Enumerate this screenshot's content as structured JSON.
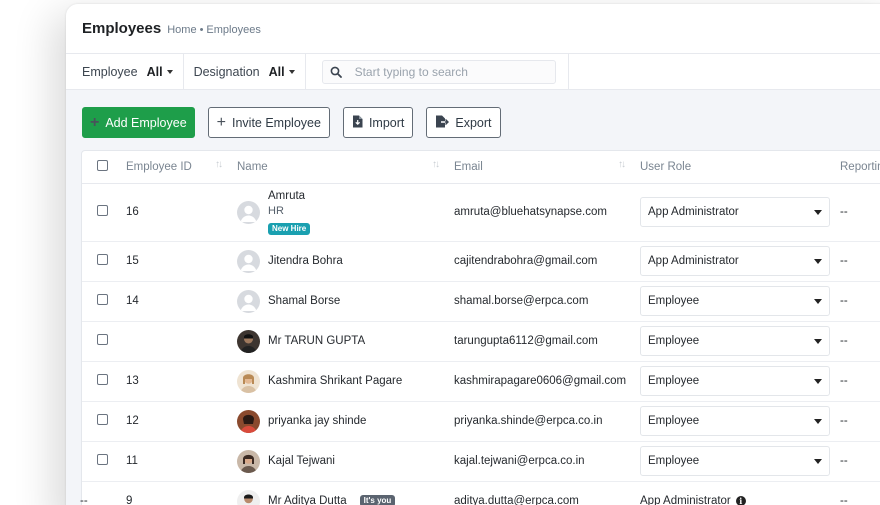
{
  "header": {
    "title": "Employees",
    "breadcrumb_home": "Home",
    "breadcrumb_sep": "•",
    "breadcrumb_current": "Employees"
  },
  "filters": {
    "employee_label": "Employee",
    "employee_value": "All",
    "designation_label": "Designation",
    "designation_value": "All",
    "search_placeholder": "Start typing to search"
  },
  "toolbar": {
    "add_label": "Add Employee",
    "invite_label": "Invite Employee",
    "import_label": "Import",
    "export_label": "Export"
  },
  "table": {
    "columns": [
      "Employee ID",
      "Name",
      "Email",
      "User Role",
      "Reportin"
    ],
    "rows": [
      {
        "id": "16",
        "name": "Amruta",
        "designation": "HR",
        "badge": "New Hire",
        "email": "amruta@bluehatsynapse.com",
        "role": "App Administrator",
        "reporting": "--"
      },
      {
        "id": "15",
        "name": "Jitendra Bohra",
        "email": "cajitendrabohra@gmail.com",
        "role": "App Administrator",
        "reporting": "--"
      },
      {
        "id": "14",
        "name": "Shamal Borse",
        "email": "shamal.borse@erpca.com",
        "role": "Employee",
        "reporting": "--"
      },
      {
        "id": "",
        "name": "Mr TARUN GUPTA",
        "email": "tarungupta6112@gmail.com",
        "role": "Employee",
        "reporting": "--"
      },
      {
        "id": "13",
        "name": "Kashmira Shrikant Pagare",
        "email": "kashmirapagare0606@gmail.com",
        "role": "Employee",
        "reporting": "--"
      },
      {
        "id": "12",
        "name": "priyanka jay shinde",
        "email": "priyanka.shinde@erpca.co.in",
        "role": "Employee",
        "reporting": "--"
      },
      {
        "id": "11",
        "name": "Kajal Tejwani",
        "email": "kajal.tejwani@erpca.co.in",
        "role": "Employee",
        "reporting": "--"
      },
      {
        "select": "--",
        "id": "9",
        "name": "Mr Aditya Dutta",
        "badge": "It's you",
        "email": "aditya.dutta@erpca.com",
        "role": "App Administrator",
        "reporting": "--"
      }
    ]
  },
  "colors": {
    "primary": "#1e9e4a",
    "new_hire_badge": "#1aa0b0",
    "its_you_badge": "#5b6470"
  }
}
